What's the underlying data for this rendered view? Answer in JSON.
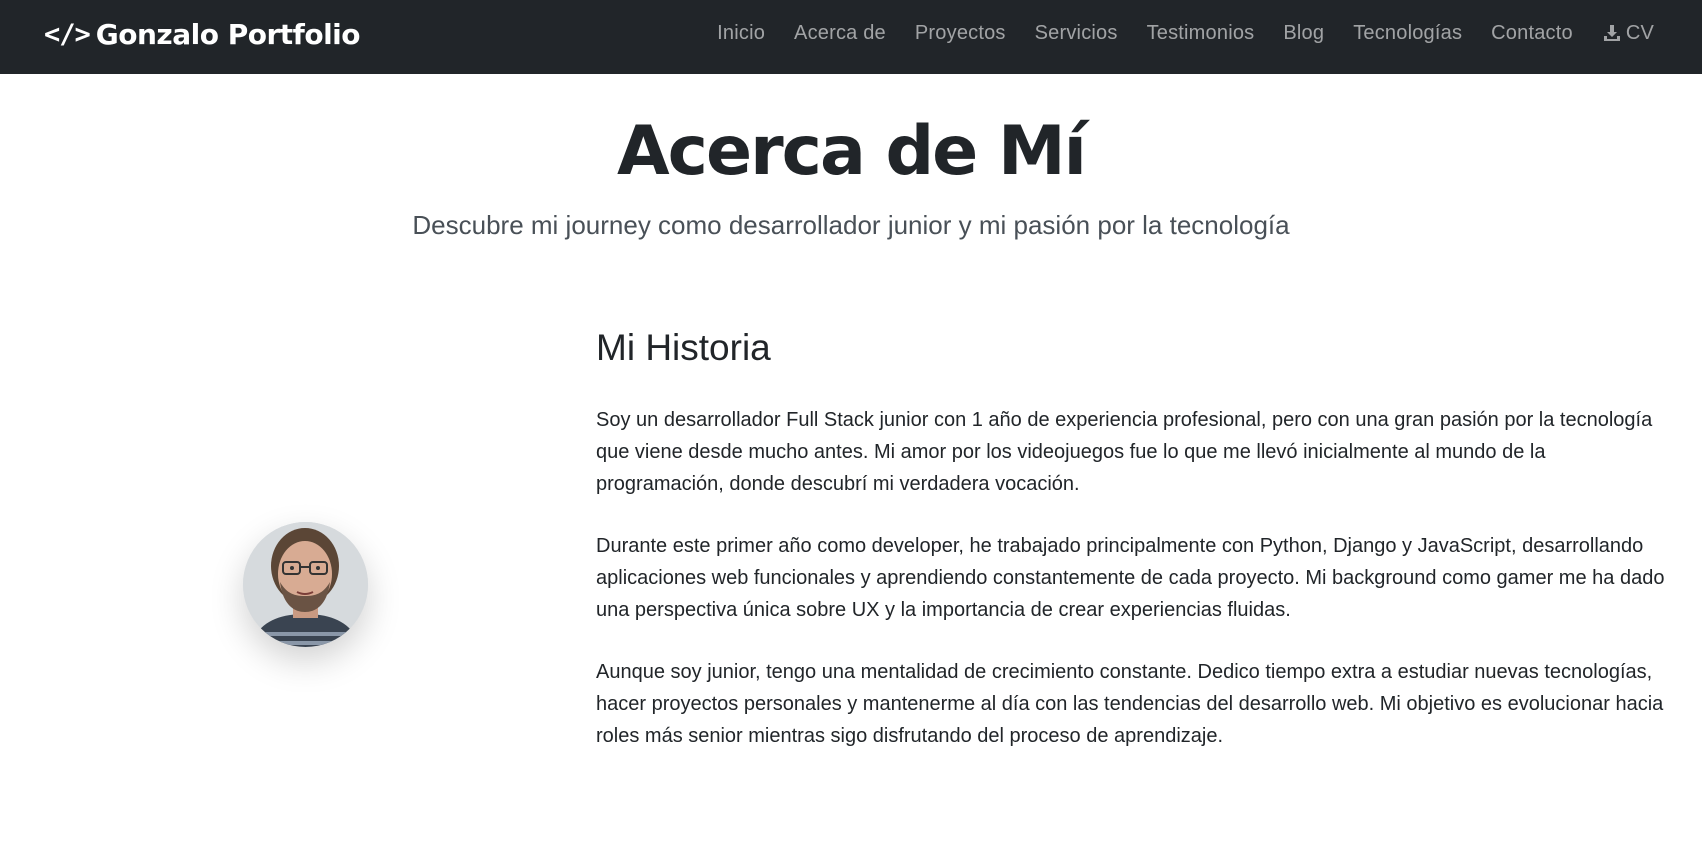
{
  "brand": {
    "icon": "code-icon",
    "icon_glyph": "</>",
    "name": "Gonzalo Portfolio"
  },
  "nav": {
    "items": [
      {
        "label": "Inicio"
      },
      {
        "label": "Acerca de"
      },
      {
        "label": "Proyectos"
      },
      {
        "label": "Servicios"
      },
      {
        "label": "Testimonios"
      },
      {
        "label": "Blog"
      },
      {
        "label": "Tecnologías"
      },
      {
        "label": "Contacto"
      }
    ],
    "cv": {
      "label": "CV",
      "icon": "download-icon"
    }
  },
  "hero": {
    "title": "Acerca de Mí",
    "subtitle": "Descubre mi journey como desarrollador junior y mi pasión por la tecnología"
  },
  "about": {
    "avatar_icon": "profile-photo",
    "heading": "Mi Historia",
    "paragraphs": [
      "Soy un desarrollador Full Stack junior con 1 año de experiencia profesional, pero con una gran pasión por la tecnología que viene desde mucho antes. Mi amor por los videojuegos fue lo que me llevó inicialmente al mundo de la programación, donde descubrí mi verdadera vocación.",
      "Durante este primer año como developer, he trabajado principalmente con Python, Django y JavaScript, desarrollando aplicaciones web funcionales y aprendiendo constantemente de cada proyecto. Mi background como gamer me ha dado una perspectiva única sobre UX y la importancia de crear experiencias fluidas.",
      "Aunque soy junior, tengo una mentalidad de crecimiento constante. Dedico tiempo extra a estudiar nuevas tecnologías, hacer proyectos personales y mantenerme al día con las tendencias del desarrollo web. Mi objetivo es evolucionar hacia roles más senior mientras sigo disfrutando del proceso de aprendizaje."
    ]
  },
  "colors": {
    "navbar_bg": "#212529",
    "nav_link": "#8f9194",
    "text": "#212529",
    "subtitle": "#495057"
  }
}
